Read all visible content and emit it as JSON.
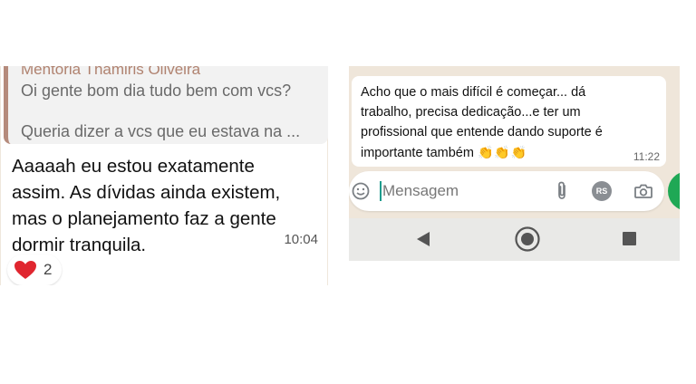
{
  "left_chat": {
    "quote": {
      "author": "Mentoria Thamiris Oliveira",
      "line1": "Oi gente bom dia tudo bem com vcs?",
      "line2": "Queria dizer a vcs que eu estava na ..."
    },
    "message": "Aaaaah eu estou exatamente assim. As dívidas ainda existem, mas o planejamento faz a gente dormir tranquila.",
    "time": "10:04",
    "reaction": {
      "icon": "heart-icon",
      "count": "2"
    }
  },
  "right_chat": {
    "message": "Acho que o mais difícil é começar... dá trabalho, precisa dedicação...e ter um profissional que entende dando suporte é importante também",
    "emoji": "👏👏👏",
    "time": "11:22",
    "input": {
      "placeholder": "Mensagem",
      "avatar_initials": "RS"
    }
  },
  "colors": {
    "chat_background": "#efe7dc",
    "quote_border": "#b58b7c",
    "quote_author": "#b0826f",
    "accent_green": "#1fa855",
    "heart": "#e0262f"
  }
}
